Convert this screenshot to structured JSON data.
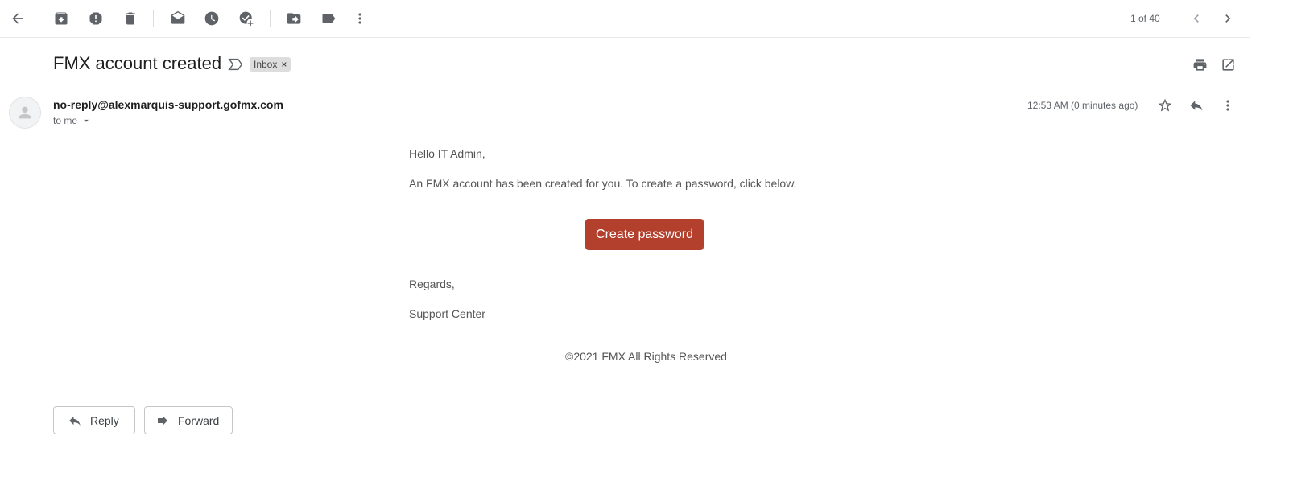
{
  "toolbar": {
    "back": {
      "icon": "arrow-back-icon"
    },
    "buttons": [
      {
        "icon": "archive-icon"
      },
      {
        "icon": "report-spam-icon"
      },
      {
        "icon": "delete-icon"
      },
      {
        "icon": "mark-unread-icon"
      },
      {
        "icon": "snooze-icon"
      },
      {
        "icon": "add-to-tasks-icon"
      },
      {
        "icon": "move-to-icon"
      },
      {
        "icon": "label-icon"
      },
      {
        "icon": "more-vert-icon"
      }
    ],
    "pager": "1 of 40",
    "older": {
      "icon": "chevron-left-icon"
    },
    "newer": {
      "icon": "chevron-right-icon"
    }
  },
  "email": {
    "subject": "FMX account created",
    "label": "Inbox",
    "label_remove": "×",
    "sender": "no-reply@alexmarquis-support.gofmx.com",
    "recipient": "to me",
    "timestamp": "12:53 AM (0 minutes ago)",
    "body": {
      "greeting": "Hello IT Admin,",
      "paragraph": "An FMX account has been created for you. To create a password, click below.",
      "button_label": "Create password",
      "regards": "Regards,",
      "signature": "Support Center",
      "copyright": "©2021 FMX All Rights Reserved"
    }
  },
  "actions": {
    "reply": "Reply",
    "forward": "Forward"
  },
  "colors": {
    "cta": "#b2402c",
    "icon": "#5f6368"
  }
}
